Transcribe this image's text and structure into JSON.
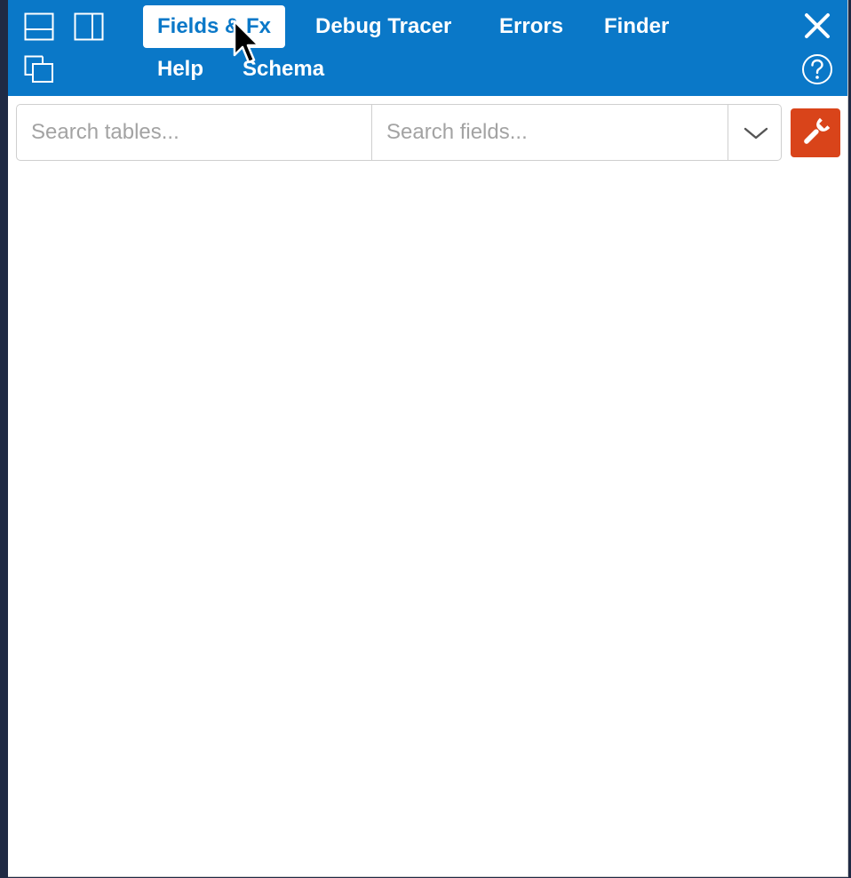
{
  "toolbar": {
    "layout_icons": [
      "dock-bottom-icon",
      "dock-right-icon",
      "pop-out-icon"
    ],
    "close_icon": "close-icon",
    "help_icon": "help-icon"
  },
  "tabs": [
    {
      "label": "Fields & Fx",
      "active": true
    },
    {
      "label": "Debug Tracer",
      "active": false
    },
    {
      "label": "Errors",
      "active": false
    },
    {
      "label": "Finder",
      "active": false
    },
    {
      "label": "Help",
      "active": false
    },
    {
      "label": "Schema",
      "active": false
    }
  ],
  "search": {
    "tables_placeholder": "Search tables...",
    "tables_value": "",
    "fields_placeholder": "Search fields...",
    "fields_value": "",
    "dropdown_icon": "chevron-down-icon"
  },
  "tools": {
    "wrench_icon": "wrench-icon"
  },
  "colors": {
    "accent": "#0a78c8",
    "tool_button": "#d9441a",
    "backdrop": "#1f2a44"
  }
}
